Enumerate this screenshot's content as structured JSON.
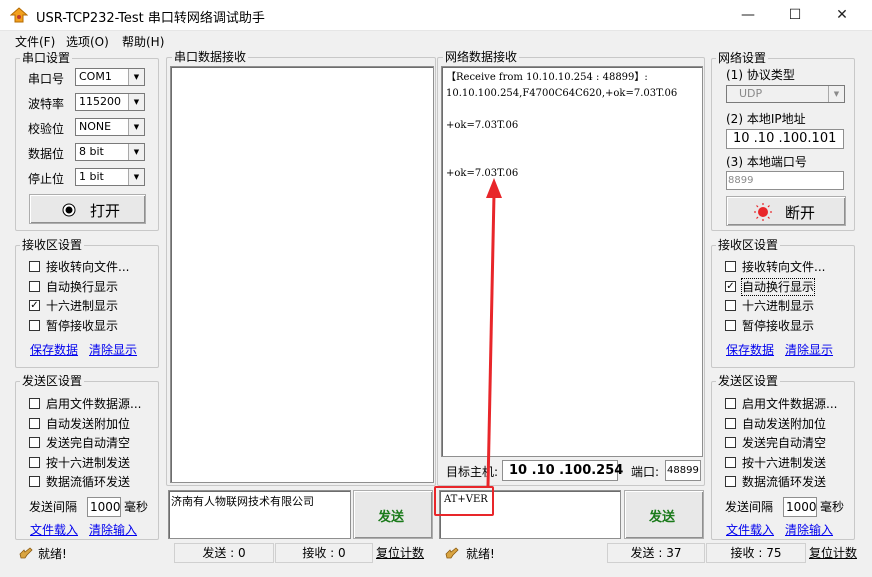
{
  "window": {
    "title": "USR-TCP232-Test 串口转网络调试助手",
    "minimize": "—",
    "maximize": "☐",
    "close": "✕"
  },
  "menu": [
    "文件(F)",
    "选项(O)",
    "帮助(H)"
  ],
  "serial_settings": {
    "title": "串口设置",
    "port_label": "串口号",
    "port_value": "COM1",
    "baud_label": "波特率",
    "baud_value": "115200",
    "parity_label": "校验位",
    "parity_value": "NONE",
    "databits_label": "数据位",
    "databits_value": "8 bit",
    "stopbits_label": "停止位",
    "stopbits_value": "1 bit",
    "open_label": "打开"
  },
  "left_receive_settings": {
    "title": "接收区设置",
    "items": [
      {
        "label": "接收转向文件...",
        "checked": ""
      },
      {
        "label": "自动换行显示",
        "checked": ""
      },
      {
        "label": "十六进制显示",
        "checked": "✓"
      },
      {
        "label": "暂停接收显示",
        "checked": ""
      }
    ],
    "save_link": "保存数据",
    "clear_link": "清除显示"
  },
  "left_send_settings": {
    "title": "发送区设置",
    "items": [
      {
        "label": "启用文件数据源...",
        "checked": ""
      },
      {
        "label": "自动发送附加位",
        "checked": ""
      },
      {
        "label": "发送完自动清空",
        "checked": ""
      },
      {
        "label": "按十六进制发送",
        "checked": ""
      },
      {
        "label": "数据流循环发送",
        "checked": ""
      }
    ],
    "interval_label": "发送间隔",
    "interval_value": "1000",
    "interval_unit": "毫秒",
    "load_link": "文件载入",
    "clear_link": "清除输入"
  },
  "serial_receive": {
    "title": "串口数据接收"
  },
  "serial_send": {
    "text": "济南有人物联网技术有限公司",
    "send_label": "发送"
  },
  "network_receive": {
    "title": "网络数据接收",
    "lines": [
      "【Receive from 10.10.10.254 : 48899】:",
      "10.10.100.254,F4700C64C620,+ok=7.03T.06",
      "",
      "+ok=7.03T.06",
      "",
      "",
      "+ok=7.03T.06"
    ]
  },
  "target": {
    "host_label": "目标主机:",
    "host_value": "10 .10 .100.254",
    "port_label": "端口:",
    "port_value": "48899"
  },
  "network_send": {
    "text": "AT+VER",
    "send_label": "发送"
  },
  "network_settings": {
    "title": "网络设置",
    "protocol_label": "(1) 协议类型",
    "protocol_value": "UDP",
    "ip_label": "(2) 本地IP地址",
    "ip_value": "10 .10 .100.101",
    "port_label": "(3) 本地端口号",
    "port_value": "8899",
    "disconnect_label": "断开"
  },
  "right_receive_settings": {
    "title": "接收区设置",
    "items": [
      {
        "label": "接收转向文件...",
        "checked": ""
      },
      {
        "label": "自动换行显示",
        "checked": "✓"
      },
      {
        "label": "十六进制显示",
        "checked": ""
      },
      {
        "label": "暂停接收显示",
        "checked": ""
      }
    ],
    "save_link": "保存数据",
    "clear_link": "清除显示"
  },
  "right_send_settings": {
    "title": "发送区设置",
    "items": [
      {
        "label": "启用文件数据源...",
        "checked": ""
      },
      {
        "label": "自动发送附加位",
        "checked": ""
      },
      {
        "label": "发送完自动清空",
        "checked": ""
      },
      {
        "label": "按十六进制发送",
        "checked": ""
      },
      {
        "label": "数据流循环发送",
        "checked": ""
      }
    ],
    "interval_label": "发送间隔",
    "interval_value": "1000",
    "interval_unit": "毫秒",
    "load_link": "文件载入",
    "clear_link": "清除输入"
  },
  "status_left": {
    "ready": "就绪!",
    "send": "发送 : 0",
    "recv": "接收 : 0",
    "reset": "复位计数"
  },
  "status_right": {
    "ready": "就绪!",
    "send": "发送 : 37",
    "recv": "接收 : 75",
    "reset": "复位计数"
  },
  "colors": {
    "annotation_red": "#e8262a",
    "record_red": "#e8262a",
    "link_blue": "#0000ee",
    "send_green": "#1a7a1a"
  }
}
